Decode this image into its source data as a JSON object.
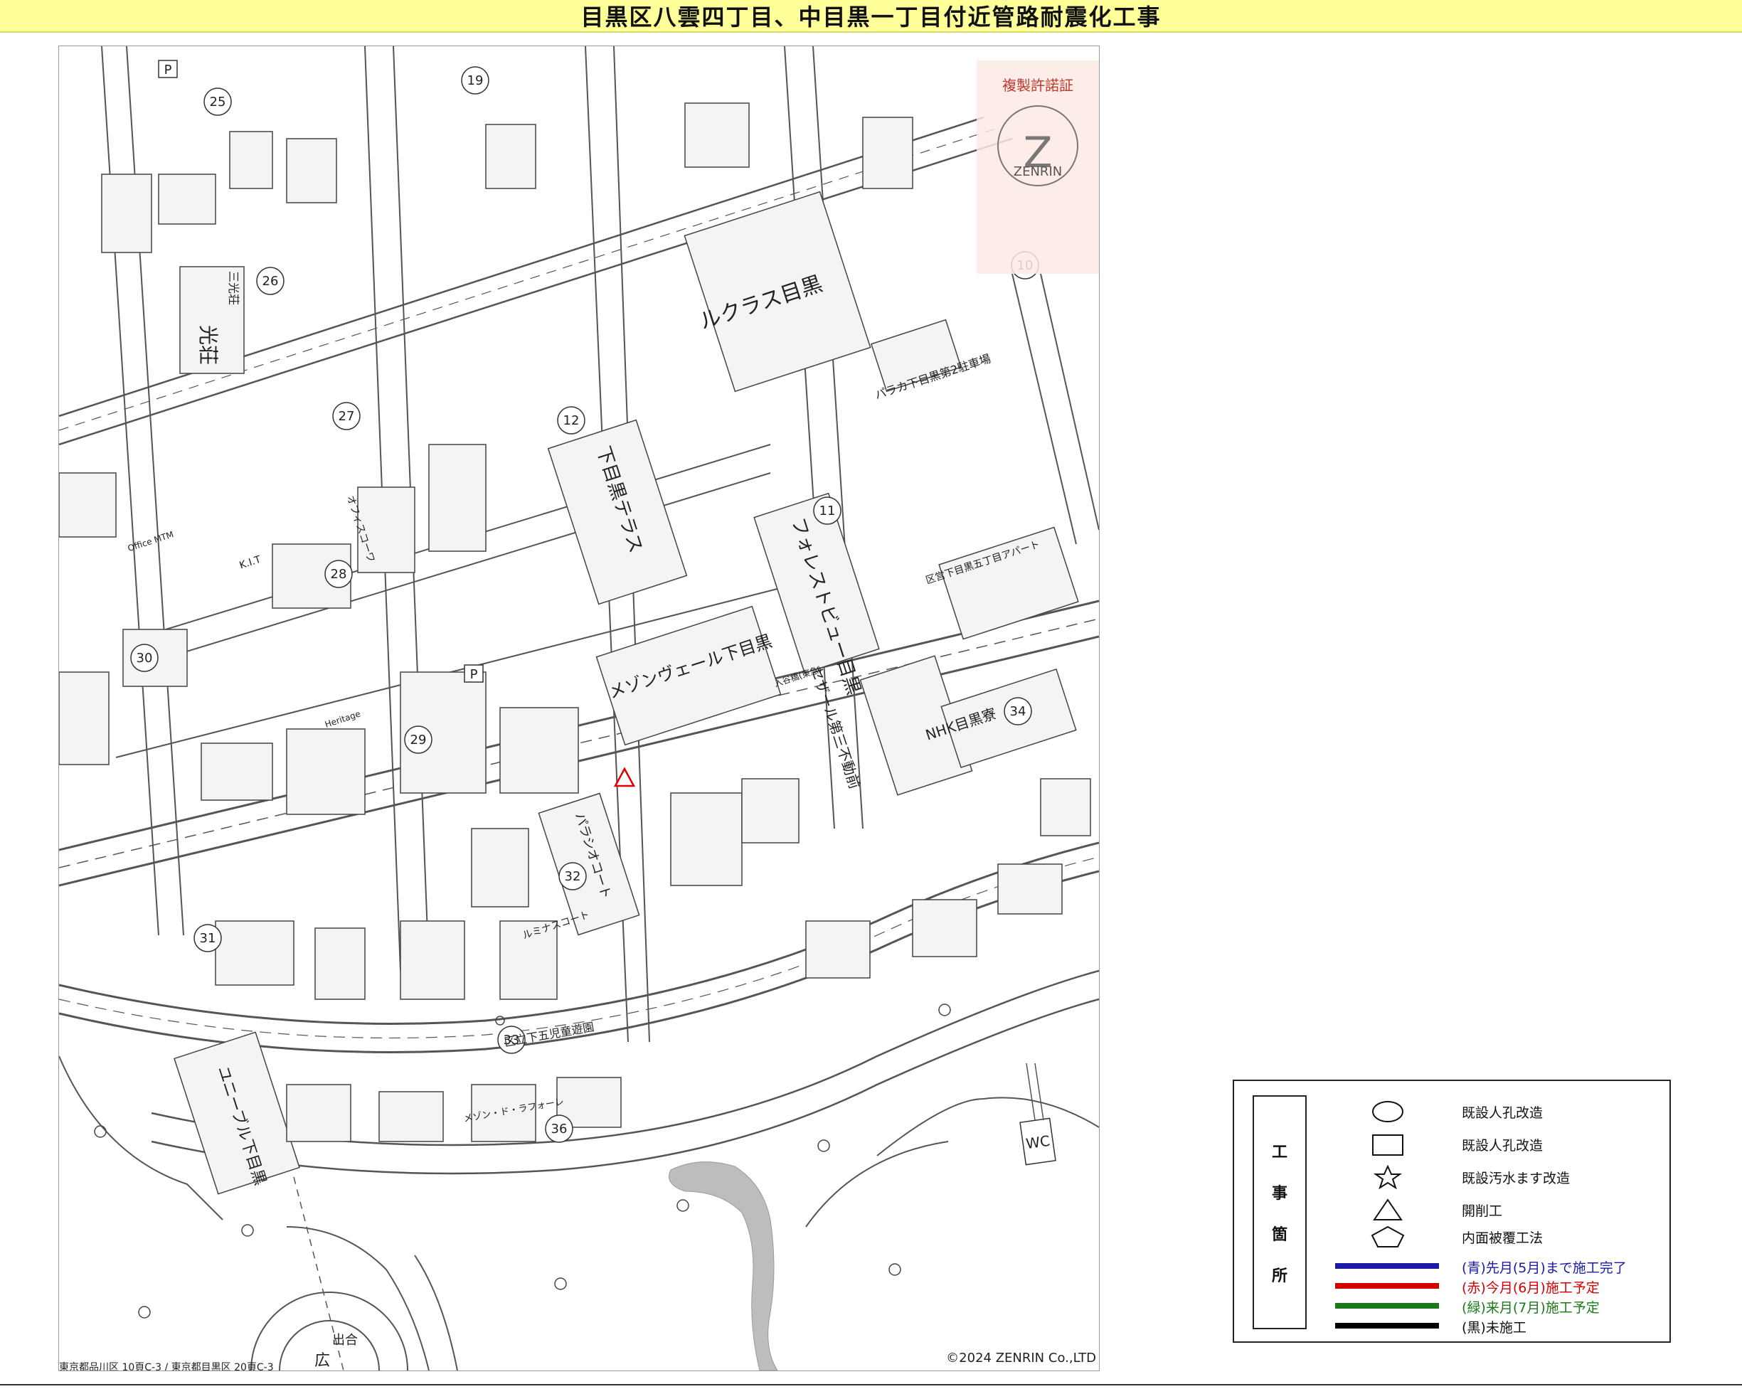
{
  "title": "目黒区八雲四丁目、中目黒一丁目付近管路耐震化工事",
  "legend": {
    "caption_chars": [
      "工",
      "事",
      "箇",
      "所"
    ],
    "items": [
      {
        "icon": "ellipse-icon",
        "label": "既設人孔改造"
      },
      {
        "icon": "square-icon",
        "label": "既設人孔改造"
      },
      {
        "icon": "star-icon",
        "label": "既設汚水ます改造"
      },
      {
        "icon": "triangle-icon",
        "label": "開削工"
      },
      {
        "icon": "pentagon-icon",
        "label": "内面被覆工法"
      }
    ],
    "lines": [
      {
        "label": "(青)先月(5月)まで施工完了",
        "color": "#1a1aa6"
      },
      {
        "label": "(赤)今月(6月)施工予定",
        "color": "#d40000"
      },
      {
        "label": "(緑)来月(7月)施工予定",
        "color": "#1a7a1a"
      },
      {
        "label": "(黒)未施工",
        "color": "#000000"
      }
    ]
  },
  "map": {
    "copyright": "©2024 ZENRIN Co.,LTD",
    "permit": {
      "line1": "複製許諾証",
      "brand": "ZENRIN"
    },
    "footer_note": "東京都品川区 10頁C-3 / 東京都目黒区 20頁C-3",
    "facilities": {
      "wc": "WC",
      "izumi": "出合",
      "hiroba": "広",
      "parking": "P"
    },
    "buildings": [
      {
        "id": "b1",
        "label": "ルクラス目黒"
      },
      {
        "id": "b2",
        "label": "下目黒テラス"
      },
      {
        "id": "b3",
        "label": "フォレストビュー目黒"
      },
      {
        "id": "b4",
        "label": "メゾンヴェール下目黒"
      },
      {
        "id": "b5",
        "label": "セザール第三不動前"
      },
      {
        "id": "b6",
        "label": "NHK目黒寮"
      },
      {
        "id": "b7",
        "label": "パラシオコート"
      },
      {
        "id": "b8",
        "label": "ユニーブル下目黒"
      },
      {
        "id": "b9",
        "label": "光荘"
      },
      {
        "id": "b10",
        "label": "三光荘"
      },
      {
        "id": "b11",
        "label": "区立下五児童遊園"
      },
      {
        "id": "b12",
        "label": "パラカ下目黒第2駐車場"
      },
      {
        "id": "b13",
        "label": "区営下目黒五丁目アパート"
      },
      {
        "id": "b14",
        "label": "Office MTM"
      },
      {
        "id": "b15",
        "label": "K.I.T"
      },
      {
        "id": "b16",
        "label": "オフィスコーワ"
      },
      {
        "id": "b17",
        "label": "ルミナスコート"
      },
      {
        "id": "b18",
        "label": "メゾン・ド・ラフォーレ"
      },
      {
        "id": "b19",
        "label": "Heritage"
      },
      {
        "id": "b20",
        "label": "入谷橋(東急)"
      }
    ],
    "numbers": [
      "25",
      "19",
      "26",
      "27",
      "12",
      "11",
      "10",
      "28",
      "30",
      "29",
      "34",
      "32",
      "31",
      "33",
      "36"
    ]
  }
}
